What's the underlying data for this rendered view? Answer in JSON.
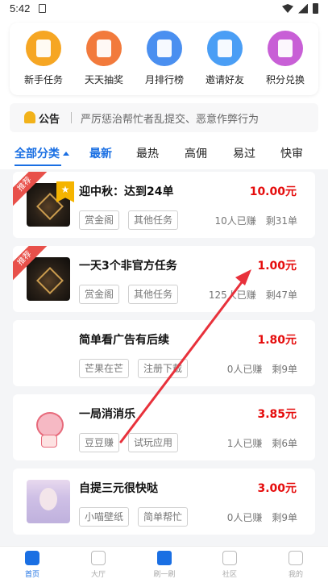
{
  "status_bar": {
    "time": "5:42"
  },
  "shortcuts": [
    {
      "label": "新手任务",
      "icon": "newbie-task-icon",
      "color": "#f6a623"
    },
    {
      "label": "天天抽奖",
      "icon": "daily-lottery-icon",
      "color": "#f27a3c"
    },
    {
      "label": "月排行榜",
      "icon": "monthly-ranking-icon",
      "color": "#4a8ff0"
    },
    {
      "label": "邀请好友",
      "icon": "invite-friends-icon",
      "color": "#4a9ef5"
    },
    {
      "label": "积分兑换",
      "icon": "points-exchange-icon",
      "color": "#c85fd6"
    }
  ],
  "notice": {
    "title": "公告",
    "text": "严厉惩治帮忙者乱提交、恶意作弊行为"
  },
  "filters": {
    "category": "全部分类",
    "tabs": [
      "最新",
      "最热",
      "高佣",
      "易过",
      "快审"
    ]
  },
  "tasks": [
    {
      "title": "迎中秋：达到24单",
      "price": "10.00元",
      "tags": [
        "赏金阁",
        "其他任务"
      ],
      "earned": "10人已赚",
      "remaining": "剩31单",
      "recommended": true,
      "ribbon": "推荐",
      "star": "★"
    },
    {
      "title": "一天3个非官方任务",
      "price": "1.00元",
      "tags": [
        "赏金阁",
        "其他任务"
      ],
      "earned": "125人已赚",
      "remaining": "剩47单",
      "recommended": true,
      "ribbon": "推荐"
    },
    {
      "title": "简单看广告有后续",
      "price": "1.80元",
      "tags": [
        "芒果在芒",
        "注册下载"
      ],
      "earned": "0人已赚",
      "remaining": "剩9单",
      "recommended": false
    },
    {
      "title": "一局消消乐",
      "price": "3.85元",
      "tags": [
        "豆豆赚",
        "试玩应用"
      ],
      "earned": "1人已赚",
      "remaining": "剩6单",
      "recommended": false
    },
    {
      "title": "自提三元很快哒",
      "price": "3.00元",
      "tags": [
        "小喵壁纸",
        "简单帮忙"
      ],
      "earned": "0人已赚",
      "remaining": "剩9单",
      "recommended": false
    }
  ],
  "bottom_nav": [
    {
      "label": "首页",
      "icon": "home-icon",
      "active": true
    },
    {
      "label": "大厅",
      "icon": "hall-icon",
      "active": false
    },
    {
      "label": "刷一刷",
      "icon": "video-icon",
      "active": false
    },
    {
      "label": "社区",
      "icon": "community-icon",
      "active": false
    },
    {
      "label": "我的",
      "icon": "profile-icon",
      "active": false
    }
  ],
  "colors": {
    "accent": "#1a6fe3",
    "price": "#e50c0c",
    "ribbon": "#e8504a",
    "annotation_arrow": "#e8313b"
  }
}
